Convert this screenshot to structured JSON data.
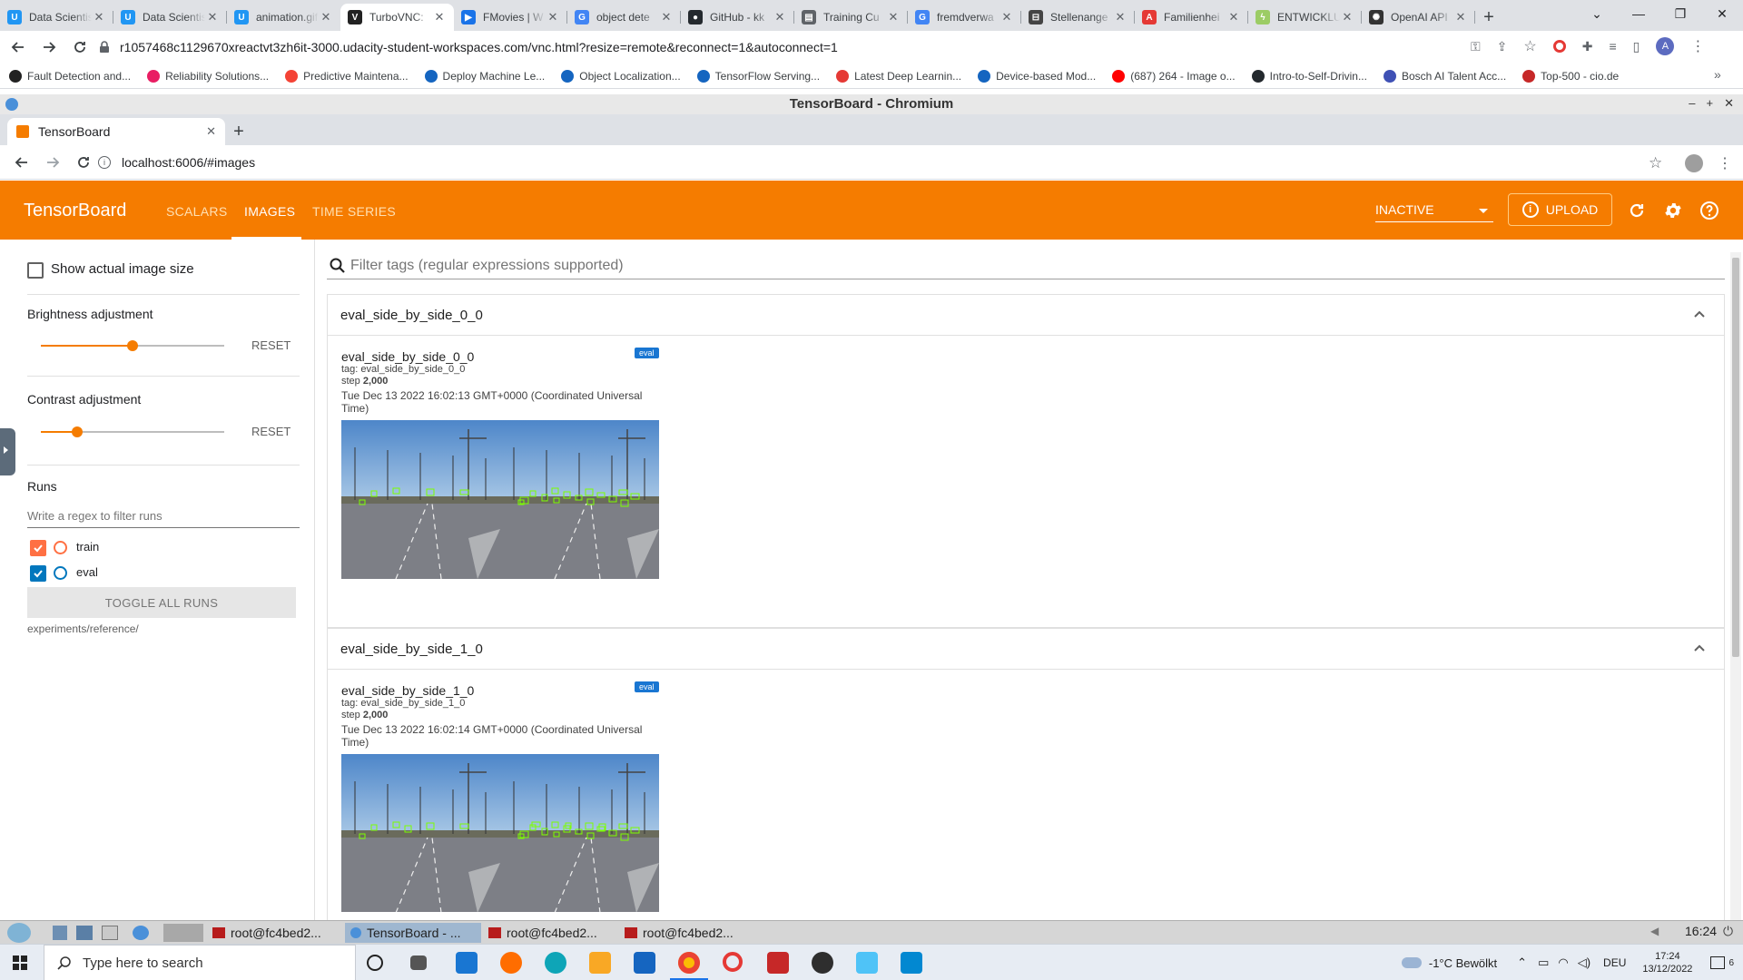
{
  "host": {
    "tabs": [
      {
        "title": "Data Scientist",
        "fav": "udacity-icon",
        "color": "#2196f3",
        "glyph": "U"
      },
      {
        "title": "Data Scientist",
        "fav": "udacity-icon",
        "color": "#2196f3",
        "glyph": "U"
      },
      {
        "title": "animation.gif",
        "fav": "udacity-icon",
        "color": "#2196f3",
        "glyph": "U"
      },
      {
        "title": "TurboVNC:",
        "fav": "vnc-icon",
        "color": "#222222",
        "glyph": "V"
      },
      {
        "title": "FMovies | W",
        "fav": "play-icon",
        "color": "#1a73e8",
        "glyph": "▶"
      },
      {
        "title": "object dete",
        "fav": "google-icon",
        "color": "#4285f4",
        "glyph": "G"
      },
      {
        "title": "GitHub - kk",
        "fav": "github-icon",
        "color": "#24292e",
        "glyph": "●"
      },
      {
        "title": "Training Cu",
        "fav": "doc-icon",
        "color": "#5f6368",
        "glyph": "▤"
      },
      {
        "title": "fremdverwa",
        "fav": "google-icon",
        "color": "#4285f4",
        "glyph": "G"
      },
      {
        "title": "Stellenange",
        "fav": "car-icon",
        "color": "#444444",
        "glyph": "⊟"
      },
      {
        "title": "Familienhei",
        "fav": "pdf-icon",
        "color": "#e53935",
        "glyph": "A"
      },
      {
        "title": "ENTWICKLU",
        "fav": "bolt-icon",
        "color": "#9ccc65",
        "glyph": "ϟ"
      },
      {
        "title": "OpenAI API",
        "fav": "openai-icon",
        "color": "#333333",
        "glyph": "✺"
      }
    ],
    "url": "r1057468c1129670xreactvt3zh6it-3000.udacity-student-workspaces.com/vnc.html?resize=remote&reconnect=1&autoconnect=1",
    "bookmarks": [
      {
        "label": "Fault Detection and...",
        "color": "#222222"
      },
      {
        "label": "Reliability Solutions...",
        "color": "#e91e63"
      },
      {
        "label": "Predictive Maintena...",
        "color": "#f44336"
      },
      {
        "label": "Deploy Machine Le...",
        "color": "#1565c0"
      },
      {
        "label": "Object Localization...",
        "color": "#1565c0"
      },
      {
        "label": "TensorFlow Serving...",
        "color": "#1565c0"
      },
      {
        "label": "Latest Deep Learnin...",
        "color": "#e53935"
      },
      {
        "label": "Device-based Mod...",
        "color": "#1565c0"
      },
      {
        "label": "(687) 264 - Image o...",
        "color": "#ff0000"
      },
      {
        "label": "Intro-to-Self-Drivin...",
        "color": "#24292e"
      },
      {
        "label": "Bosch AI Talent Acc...",
        "color": "#3f51b5"
      },
      {
        "label": "Top-500 - cio.de",
        "color": "#c62828"
      }
    ]
  },
  "vnc": {
    "window_title": "TensorBoard - Chromium",
    "tab_title": "TensorBoard",
    "url": "localhost:6006/#images",
    "taskbar": {
      "items": [
        "root@fc4bed2...",
        "TensorBoard - ...",
        "root@fc4bed2...",
        "root@fc4bed2..."
      ],
      "clock": "16:24"
    }
  },
  "tb": {
    "brand": "TensorBoard",
    "nav": [
      "SCALARS",
      "IMAGES",
      "TIME SERIES"
    ],
    "active_nav": "IMAGES",
    "reload_status": "INACTIVE",
    "upload_label": "UPLOAD",
    "accent": "#f57c00",
    "sidebar": {
      "show_actual_size": "Show actual image size",
      "brightness_label": "Brightness adjustment",
      "brightness_value": 0.5,
      "contrast_label": "Contrast adjustment",
      "contrast_value": 0.2,
      "reset_label": "RESET",
      "runs_label": "Runs",
      "runs_filter_placeholder": "Write a regex to filter runs",
      "runs": [
        {
          "name": "train",
          "checked": true,
          "color": "#ff7043"
        },
        {
          "name": "eval",
          "checked": true,
          "color": "#0277bd"
        }
      ],
      "toggle_all": "TOGGLE ALL RUNS",
      "logdir": "experiments/reference/"
    },
    "filter_placeholder": "Filter tags (regular expressions supported)",
    "cards": [
      {
        "header": "eval_side_by_side_0_0",
        "title": "eval_side_by_side_0_0",
        "tag": "tag: eval_side_by_side_0_0",
        "step_label": "step",
        "step": "2,000",
        "time": "Tue Dec 13 2022 16:02:13 GMT+0000 (Coordinated Universal Time)",
        "run": "eval"
      },
      {
        "header": "eval_side_by_side_1_0",
        "title": "eval_side_by_side_1_0",
        "tag": "tag: eval_side_by_side_1_0",
        "step_label": "step",
        "step": "2,000",
        "time": "Tue Dec 13 2022 16:02:14 GMT+0000 (Coordinated Universal Time)",
        "run": "eval"
      }
    ]
  },
  "windows": {
    "search_placeholder": "Type here to search",
    "weather": "-1°C  Bewölkt",
    "lang": "DEU",
    "time": "17:24",
    "date": "13/12/2022",
    "notifications": "6"
  }
}
